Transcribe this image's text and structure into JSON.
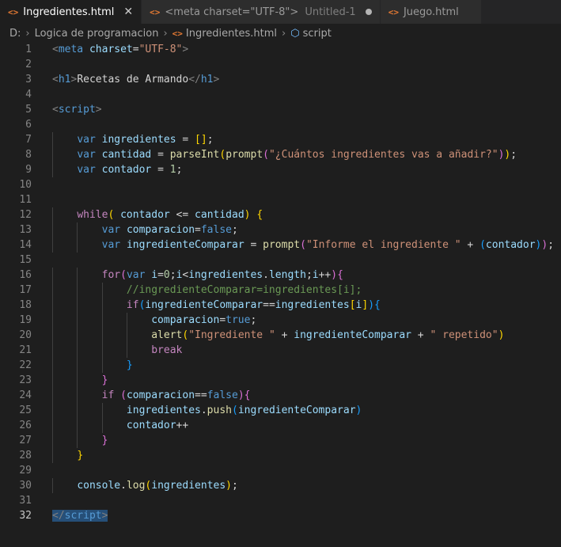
{
  "tabs": [
    {
      "label": "Ingredientes.html",
      "active": true,
      "icon": "html-file-icon"
    },
    {
      "label": "<meta charset=\"UTF-8\">",
      "sub": "Untitled-1",
      "modified": true,
      "icon": "html-file-icon"
    },
    {
      "label": "Juego.html",
      "icon": "html-file-icon"
    }
  ],
  "breadcrumb": {
    "drive": "D:",
    "folder": "Logica de programacion",
    "file": "Ingredientes.html",
    "symbol": "script"
  },
  "editor": {
    "current_line": 32,
    "lines": [
      {
        "n": "1",
        "tokens": [
          [
            "punc",
            "<"
          ],
          [
            "tag",
            "meta"
          ],
          [
            "txt",
            " "
          ],
          [
            "attr",
            "charset"
          ],
          [
            "txt",
            "="
          ],
          [
            "str",
            "\"UTF-8\""
          ],
          [
            "punc",
            ">"
          ]
        ]
      },
      {
        "n": "2",
        "tokens": []
      },
      {
        "n": "3",
        "tokens": [
          [
            "punc",
            "<"
          ],
          [
            "tag",
            "h1"
          ],
          [
            "punc",
            ">"
          ],
          [
            "txt",
            "Recetas de Armando"
          ],
          [
            "punc",
            "</"
          ],
          [
            "tag",
            "h1"
          ],
          [
            "punc",
            ">"
          ]
        ]
      },
      {
        "n": "4",
        "tokens": []
      },
      {
        "n": "5",
        "tokens": [
          [
            "punc",
            "<"
          ],
          [
            "tag",
            "script"
          ],
          [
            "punc",
            ">"
          ]
        ]
      },
      {
        "n": "6",
        "tokens": []
      },
      {
        "n": "7",
        "tokens": [
          [
            "txt",
            "    "
          ],
          [
            "kw",
            "var"
          ],
          [
            "txt",
            " "
          ],
          [
            "var",
            "ingredientes"
          ],
          [
            "txt",
            " = "
          ],
          [
            "b1",
            "[]"
          ],
          [
            "txt",
            ";"
          ]
        ]
      },
      {
        "n": "8",
        "tokens": [
          [
            "txt",
            "    "
          ],
          [
            "kw",
            "var"
          ],
          [
            "txt",
            " "
          ],
          [
            "var",
            "cantidad"
          ],
          [
            "txt",
            " = "
          ],
          [
            "fn",
            "parseInt"
          ],
          [
            "b1",
            "("
          ],
          [
            "fn",
            "prompt"
          ],
          [
            "b2",
            "("
          ],
          [
            "str",
            "\"¿Cuántos ingredientes vas a añadir?\""
          ],
          [
            "b2",
            ")"
          ],
          [
            "b1",
            ")"
          ],
          [
            "txt",
            ";"
          ]
        ]
      },
      {
        "n": "9",
        "tokens": [
          [
            "txt",
            "    "
          ],
          [
            "kw",
            "var"
          ],
          [
            "txt",
            " "
          ],
          [
            "var",
            "contador"
          ],
          [
            "txt",
            " = "
          ],
          [
            "num",
            "1"
          ],
          [
            "txt",
            ";"
          ]
        ]
      },
      {
        "n": "10",
        "tokens": []
      },
      {
        "n": "11",
        "tokens": []
      },
      {
        "n": "12",
        "tokens": [
          [
            "txt",
            "    "
          ],
          [
            "ctl",
            "while"
          ],
          [
            "b1",
            "("
          ],
          [
            "txt",
            " "
          ],
          [
            "var",
            "contador"
          ],
          [
            "txt",
            " <= "
          ],
          [
            "var",
            "cantidad"
          ],
          [
            "b1",
            ")"
          ],
          [
            "txt",
            " "
          ],
          [
            "b1",
            "{"
          ]
        ]
      },
      {
        "n": "13",
        "tokens": [
          [
            "txt",
            "        "
          ],
          [
            "kw",
            "var"
          ],
          [
            "txt",
            " "
          ],
          [
            "var",
            "comparacion"
          ],
          [
            "txt",
            "="
          ],
          [
            "kw",
            "false"
          ],
          [
            "txt",
            ";"
          ]
        ]
      },
      {
        "n": "14",
        "tokens": [
          [
            "txt",
            "        "
          ],
          [
            "kw",
            "var"
          ],
          [
            "txt",
            " "
          ],
          [
            "var",
            "ingredienteComparar"
          ],
          [
            "txt",
            " = "
          ],
          [
            "fn",
            "prompt"
          ],
          [
            "b2",
            "("
          ],
          [
            "str",
            "\"Informe el ingrediente \""
          ],
          [
            "txt",
            " + "
          ],
          [
            "b3",
            "("
          ],
          [
            "var",
            "contador"
          ],
          [
            "b3",
            ")"
          ],
          [
            "b2",
            ")"
          ],
          [
            "txt",
            ";"
          ]
        ]
      },
      {
        "n": "15",
        "tokens": []
      },
      {
        "n": "16",
        "tokens": [
          [
            "txt",
            "        "
          ],
          [
            "ctl",
            "for"
          ],
          [
            "b2",
            "("
          ],
          [
            "kw",
            "var"
          ],
          [
            "txt",
            " "
          ],
          [
            "var",
            "i"
          ],
          [
            "txt",
            "="
          ],
          [
            "num",
            "0"
          ],
          [
            "txt",
            ";"
          ],
          [
            "var",
            "i"
          ],
          [
            "txt",
            "<"
          ],
          [
            "var",
            "ingredientes"
          ],
          [
            "txt",
            "."
          ],
          [
            "var",
            "length"
          ],
          [
            "txt",
            ";"
          ],
          [
            "var",
            "i"
          ],
          [
            "txt",
            "++"
          ],
          [
            "b2",
            ")"
          ],
          [
            "b2",
            "{"
          ]
        ]
      },
      {
        "n": "17",
        "tokens": [
          [
            "txt",
            "            "
          ],
          [
            "cm",
            "//ingredienteComparar=ingredientes[i];"
          ]
        ]
      },
      {
        "n": "18",
        "tokens": [
          [
            "txt",
            "            "
          ],
          [
            "ctl",
            "if"
          ],
          [
            "b3",
            "("
          ],
          [
            "var",
            "ingredienteComparar"
          ],
          [
            "txt",
            "=="
          ],
          [
            "var",
            "ingredientes"
          ],
          [
            "b1",
            "["
          ],
          [
            "var",
            "i"
          ],
          [
            "b1",
            "]"
          ],
          [
            "b3",
            ")"
          ],
          [
            "b3",
            "{"
          ]
        ]
      },
      {
        "n": "19",
        "tokens": [
          [
            "txt",
            "                "
          ],
          [
            "var",
            "comparacion"
          ],
          [
            "txt",
            "="
          ],
          [
            "kw",
            "true"
          ],
          [
            "txt",
            ";"
          ]
        ]
      },
      {
        "n": "20",
        "tokens": [
          [
            "txt",
            "                "
          ],
          [
            "fn",
            "alert"
          ],
          [
            "b1",
            "("
          ],
          [
            "str",
            "\"Ingrediente \""
          ],
          [
            "txt",
            " + "
          ],
          [
            "var",
            "ingredienteComparar"
          ],
          [
            "txt",
            " + "
          ],
          [
            "str",
            "\" repetido\""
          ],
          [
            "b1",
            ")"
          ]
        ]
      },
      {
        "n": "21",
        "tokens": [
          [
            "txt",
            "                "
          ],
          [
            "ctl",
            "break"
          ]
        ]
      },
      {
        "n": "22",
        "tokens": [
          [
            "txt",
            "            "
          ],
          [
            "b3",
            "}"
          ]
        ]
      },
      {
        "n": "23",
        "tokens": [
          [
            "txt",
            "        "
          ],
          [
            "b2",
            "}"
          ]
        ]
      },
      {
        "n": "24",
        "tokens": [
          [
            "txt",
            "        "
          ],
          [
            "ctl",
            "if"
          ],
          [
            "txt",
            " "
          ],
          [
            "b2",
            "("
          ],
          [
            "var",
            "comparacion"
          ],
          [
            "txt",
            "=="
          ],
          [
            "kw",
            "false"
          ],
          [
            "b2",
            ")"
          ],
          [
            "b2",
            "{"
          ]
        ]
      },
      {
        "n": "25",
        "tokens": [
          [
            "txt",
            "            "
          ],
          [
            "var",
            "ingredientes"
          ],
          [
            "txt",
            "."
          ],
          [
            "fn",
            "push"
          ],
          [
            "b3",
            "("
          ],
          [
            "var",
            "ingredienteComparar"
          ],
          [
            "b3",
            ")"
          ]
        ]
      },
      {
        "n": "26",
        "tokens": [
          [
            "txt",
            "            "
          ],
          [
            "var",
            "contador"
          ],
          [
            "txt",
            "++"
          ]
        ]
      },
      {
        "n": "27",
        "tokens": [
          [
            "txt",
            "        "
          ],
          [
            "b2",
            "}"
          ]
        ]
      },
      {
        "n": "28",
        "tokens": [
          [
            "txt",
            "    "
          ],
          [
            "b1",
            "}"
          ]
        ]
      },
      {
        "n": "29",
        "tokens": []
      },
      {
        "n": "30",
        "tokens": [
          [
            "txt",
            "    "
          ],
          [
            "var",
            "console"
          ],
          [
            "txt",
            "."
          ],
          [
            "fn",
            "log"
          ],
          [
            "b1",
            "("
          ],
          [
            "var",
            "ingredientes"
          ],
          [
            "b1",
            ")"
          ],
          [
            "txt",
            ";"
          ]
        ]
      },
      {
        "n": "31",
        "tokens": []
      },
      {
        "n": "32",
        "tokens": [
          [
            "sel-punc",
            "</"
          ],
          [
            "sel-tag",
            "script"
          ],
          [
            "sel-punc",
            ">"
          ]
        ]
      }
    ]
  }
}
